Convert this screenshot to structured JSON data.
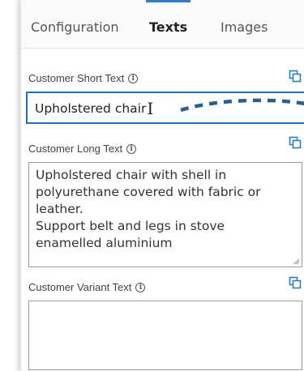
{
  "tabs": [
    {
      "label": "Configuration"
    },
    {
      "label": "Texts"
    },
    {
      "label": "Images"
    }
  ],
  "fields": {
    "short": {
      "label": "Customer Short Text",
      "value": "Upholstered chair"
    },
    "long": {
      "label": "Customer Long Text",
      "lines": [
        "Upholstered chair with shell in",
        "polyurethane covered with fabric or",
        "leather.",
        "Support belt and legs in stove",
        "enamelled aluminium"
      ]
    },
    "variant": {
      "label": "Customer Variant Text",
      "value": ""
    }
  },
  "icons": {
    "info": "info-icon",
    "copy": "copy-icon",
    "cursor": "text-cursor-icon"
  },
  "colors": {
    "accent": "#1f6fbf",
    "dash": "#2a5f93"
  }
}
